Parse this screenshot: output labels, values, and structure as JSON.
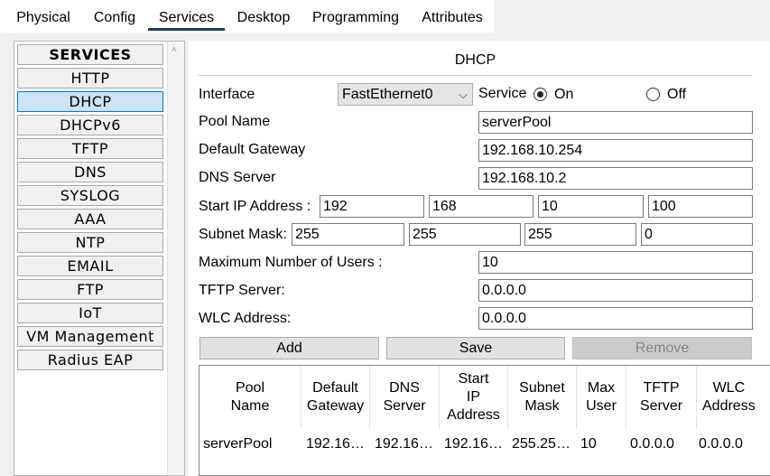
{
  "tabs": [
    "Physical",
    "Config",
    "Services",
    "Desktop",
    "Programming",
    "Attributes"
  ],
  "sidebar": {
    "header": "SERVICES",
    "items": [
      "HTTP",
      "DHCP",
      "DHCPv6",
      "TFTP",
      "DNS",
      "SYSLOG",
      "AAA",
      "NTP",
      "EMAIL",
      "FTP",
      "IoT",
      "VM Management",
      "Radius EAP"
    ],
    "selected": "DHCP"
  },
  "panel": {
    "title": "DHCP",
    "interface_label": "Interface",
    "interface_value": "FastEthernet0",
    "service_label": "Service",
    "on_label": "On",
    "off_label": "Off",
    "service_state": "On",
    "pool_name_label": "Pool Name",
    "pool_name": "serverPool",
    "default_gateway_label": "Default Gateway",
    "default_gateway": "192.168.10.254",
    "dns_server_label": "DNS Server",
    "dns_server": "192.168.10.2",
    "start_ip_label": "Start IP Address :",
    "start_ip": [
      "192",
      "168",
      "10",
      "100"
    ],
    "subnet_mask_label": "Subnet Mask:",
    "subnet_mask": [
      "255",
      "255",
      "255",
      "0"
    ],
    "max_users_label": "Maximum Number of Users :",
    "max_users": "10",
    "tftp_server_label": "TFTP Server:",
    "tftp_server": "0.0.0.0",
    "wlc_address_label": "WLC Address:",
    "wlc_address": "0.0.0.0"
  },
  "buttons": {
    "add": "Add",
    "save": "Save",
    "remove": "Remove"
  },
  "table": {
    "headers": [
      "Pool\nName",
      "Default\nGateway",
      "DNS\nServer",
      "Start\nIP\nAddress",
      "Subnet\nMask",
      "Max\nUser",
      "TFTP\nServer",
      "WLC\nAddress"
    ],
    "rows": [
      [
        "serverPool",
        "192.16…",
        "192.16…",
        "192.16…",
        "255.25…",
        "10",
        "0.0.0.0",
        "0.0.0.0"
      ]
    ]
  }
}
